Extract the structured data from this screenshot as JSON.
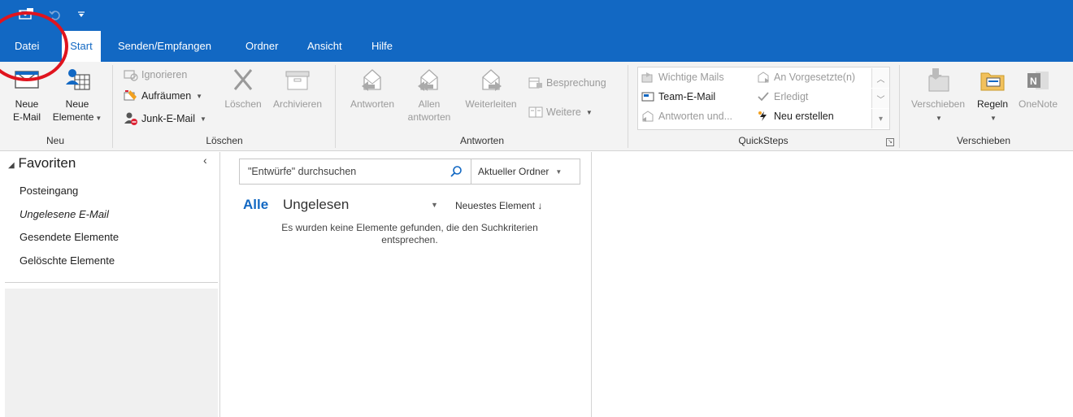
{
  "qat": {
    "icons": [
      "send-receive-icon",
      "undo-icon",
      "customize-qat-icon"
    ]
  },
  "tabs": [
    {
      "label": "Datei"
    },
    {
      "label": "Start"
    },
    {
      "label": "Senden/Empfangen"
    },
    {
      "label": "Ordner"
    },
    {
      "label": "Ansicht"
    },
    {
      "label": "Hilfe"
    }
  ],
  "ribbon": {
    "neu": {
      "group_label": "Neu",
      "new_email_line1": "Neue",
      "new_email_line2": "E-Mail",
      "new_items_line1": "Neue",
      "new_items_line2": "Elemente"
    },
    "loeschen": {
      "group_label": "Löschen",
      "ignore": "Ignorieren",
      "cleanup": "Aufräumen",
      "junk": "Junk-E-Mail",
      "delete": "Löschen",
      "archive": "Archivieren"
    },
    "antworten": {
      "group_label": "Antworten",
      "reply": "Antworten",
      "reply_all_line1": "Allen",
      "reply_all_line2": "antworten",
      "forward": "Weiterleiten",
      "meeting": "Besprechung",
      "more": "Weitere"
    },
    "quicksteps": {
      "group_label": "QuickSteps",
      "items": [
        {
          "label": "Wichtige Mails",
          "icon": "move-to-icon",
          "disabled": true
        },
        {
          "label": "An Vorgesetzte(n)",
          "icon": "forward-manager-icon",
          "disabled": true
        },
        {
          "label": "Team-E-Mail",
          "icon": "team-email-icon",
          "disabled": false
        },
        {
          "label": "Erledigt",
          "icon": "checkmark-icon",
          "disabled": true
        },
        {
          "label": "Antworten und...",
          "icon": "reply-delete-icon",
          "disabled": true
        },
        {
          "label": "Neu erstellen",
          "icon": "lightning-icon",
          "disabled": false
        }
      ]
    },
    "verschieben": {
      "group_label": "Verschieben",
      "move": "Verschieben",
      "rules": "Regeln",
      "onenote": "OneNote"
    }
  },
  "nav": {
    "collapse_glyph": "‹",
    "favorites_header": "Favoriten",
    "items": [
      {
        "label": "Posteingang"
      },
      {
        "label": "Ungelesene E-Mail"
      },
      {
        "label": "Gesendete Elemente"
      },
      {
        "label": "Gelöschte Elemente"
      }
    ]
  },
  "msglist": {
    "search_placeholder": "\"Entwürfe\" durchsuchen",
    "scope": "Aktueller Ordner",
    "filter_all": "Alle",
    "filter_unread": "Ungelesen",
    "sort": "Neuestes Element ↓",
    "empty_line1": "Es wurden keine Elemente gefunden, die den Suchkriterien",
    "empty_line2": "entsprechen."
  },
  "colors": {
    "accent": "#1268c3",
    "annotation": "#e0141e"
  }
}
